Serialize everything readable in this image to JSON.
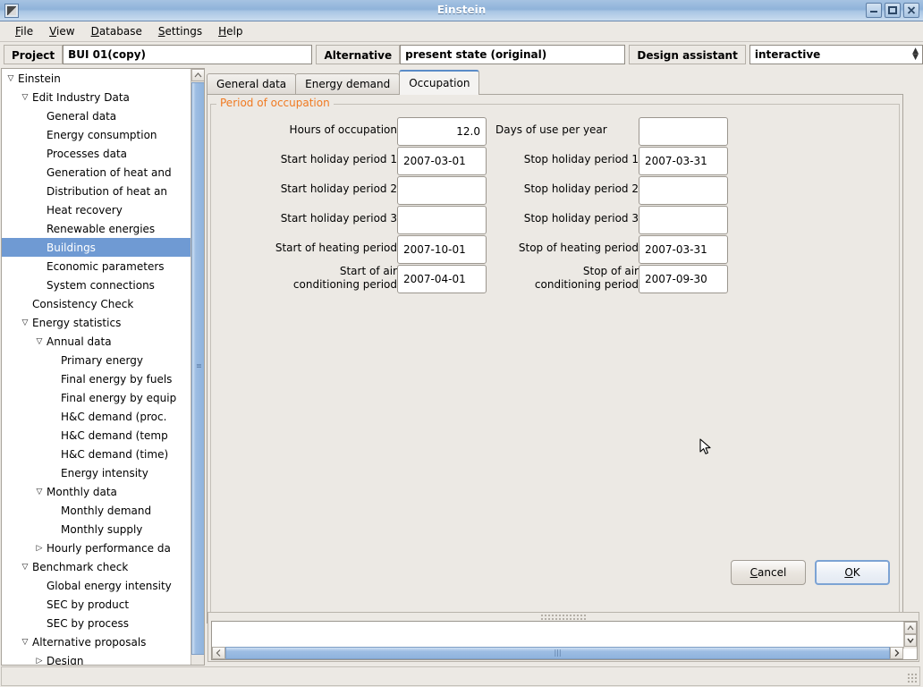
{
  "window": {
    "title": "Einstein",
    "icon": "app-icon",
    "buttons": [
      {
        "name": "minimize",
        "glyph": "minimize-icon"
      },
      {
        "name": "maximize",
        "glyph": "maximize-icon"
      },
      {
        "name": "close",
        "glyph": "close-icon"
      }
    ]
  },
  "menubar": {
    "items": [
      {
        "label": "File",
        "mnemonic": "F"
      },
      {
        "label": "View",
        "mnemonic": "V"
      },
      {
        "label": "Database",
        "mnemonic": "D"
      },
      {
        "label": "Settings",
        "mnemonic": "S"
      },
      {
        "label": "Help",
        "mnemonic": "H"
      }
    ]
  },
  "toolbar": {
    "project_label": "Project",
    "project_value": "BUI 01(copy)",
    "alternative_label": "Alternative",
    "alternative_value": "present state (original)",
    "design_assistant_label": "Design assistant",
    "design_assistant_value": "interactive"
  },
  "tree": {
    "selected": "Buildings",
    "items": [
      {
        "label": "Einstein",
        "indent": 0,
        "arrow": "expanded",
        "selected": false
      },
      {
        "label": "Edit Industry Data",
        "indent": 1,
        "arrow": "expanded",
        "selected": false
      },
      {
        "label": "General data",
        "indent": 2,
        "arrow": "none",
        "selected": false
      },
      {
        "label": "Energy consumption",
        "indent": 2,
        "arrow": "none",
        "selected": false
      },
      {
        "label": "Processes data",
        "indent": 2,
        "arrow": "none",
        "selected": false
      },
      {
        "label": "Generation of heat and",
        "indent": 2,
        "arrow": "none",
        "selected": false
      },
      {
        "label": "Distribution of heat an",
        "indent": 2,
        "arrow": "none",
        "selected": false
      },
      {
        "label": "Heat recovery",
        "indent": 2,
        "arrow": "none",
        "selected": false
      },
      {
        "label": "Renewable energies",
        "indent": 2,
        "arrow": "none",
        "selected": false
      },
      {
        "label": "Buildings",
        "indent": 2,
        "arrow": "none",
        "selected": true
      },
      {
        "label": "Economic parameters",
        "indent": 2,
        "arrow": "none",
        "selected": false
      },
      {
        "label": "System connections",
        "indent": 2,
        "arrow": "none",
        "selected": false
      },
      {
        "label": "Consistency Check",
        "indent": 1,
        "arrow": "none",
        "selected": false
      },
      {
        "label": "Energy statistics",
        "indent": 1,
        "arrow": "expanded",
        "selected": false
      },
      {
        "label": "Annual data",
        "indent": 2,
        "arrow": "expanded",
        "selected": false
      },
      {
        "label": "Primary energy",
        "indent": 3,
        "arrow": "none",
        "selected": false
      },
      {
        "label": "Final energy by fuels",
        "indent": 3,
        "arrow": "none",
        "selected": false
      },
      {
        "label": "Final energy by equip",
        "indent": 3,
        "arrow": "none",
        "selected": false
      },
      {
        "label": "H&C demand (proc.",
        "indent": 3,
        "arrow": "none",
        "selected": false
      },
      {
        "label": "H&C demand (temp",
        "indent": 3,
        "arrow": "none",
        "selected": false
      },
      {
        "label": "H&C demand (time)",
        "indent": 3,
        "arrow": "none",
        "selected": false
      },
      {
        "label": "Energy intensity",
        "indent": 3,
        "arrow": "none",
        "selected": false
      },
      {
        "label": "Monthly data",
        "indent": 2,
        "arrow": "expanded",
        "selected": false
      },
      {
        "label": "Monthly demand",
        "indent": 3,
        "arrow": "none",
        "selected": false
      },
      {
        "label": "Monthly supply",
        "indent": 3,
        "arrow": "none",
        "selected": false
      },
      {
        "label": "Hourly performance da",
        "indent": 2,
        "arrow": "collapsed",
        "selected": false
      },
      {
        "label": "Benchmark check",
        "indent": 1,
        "arrow": "expanded",
        "selected": false
      },
      {
        "label": "Global energy intensity",
        "indent": 2,
        "arrow": "none",
        "selected": false
      },
      {
        "label": "SEC by product",
        "indent": 2,
        "arrow": "none",
        "selected": false
      },
      {
        "label": "SEC by process",
        "indent": 2,
        "arrow": "none",
        "selected": false
      },
      {
        "label": "Alternative proposals",
        "indent": 1,
        "arrow": "expanded",
        "selected": false
      },
      {
        "label": "Design",
        "indent": 2,
        "arrow": "collapsed",
        "selected": false
      }
    ]
  },
  "tabs": [
    {
      "label": "General data",
      "active": false
    },
    {
      "label": "Energy demand",
      "active": false
    },
    {
      "label": "Occupation",
      "active": true
    }
  ],
  "groupbox": {
    "title": "Period of occupation",
    "title_color": "#f07a21"
  },
  "form": {
    "rows": [
      {
        "left_label": "Hours of occupation",
        "left_value": "12.0",
        "left_numeric": true,
        "right_label": "Days of use per year",
        "right_value": ""
      },
      {
        "left_label": "Start holiday period 1",
        "left_value": "2007-03-01",
        "left_numeric": false,
        "right_label": "Stop holiday period 1",
        "right_value": "2007-03-31"
      },
      {
        "left_label": "Start holiday period 2",
        "left_value": "",
        "left_numeric": false,
        "right_label": "Stop holiday period 2",
        "right_value": ""
      },
      {
        "left_label": "Start holiday period 3",
        "left_value": "",
        "left_numeric": false,
        "right_label": "Stop holiday period 3",
        "right_value": ""
      },
      {
        "left_label": "Start of heating period",
        "left_value": "2007-10-01",
        "left_numeric": false,
        "right_label": "Stop of heating period",
        "right_value": "2007-03-31"
      },
      {
        "left_label": "Start of air\nconditioning period",
        "left_value": "2007-04-01",
        "left_numeric": false,
        "right_label": "Stop of air\nconditioning period",
        "right_value": "2007-09-30"
      }
    ]
  },
  "buttons": {
    "cancel": "Cancel",
    "cancel_mnemonic": "C",
    "ok": "OK",
    "ok_mnemonic": "O"
  },
  "log": {
    "text": ""
  },
  "colors": {
    "selection": "#6f9ad3",
    "accent_orange": "#f07a21",
    "window_bg": "#ece9e4",
    "title_gradient_top": "#a6c3e2"
  }
}
